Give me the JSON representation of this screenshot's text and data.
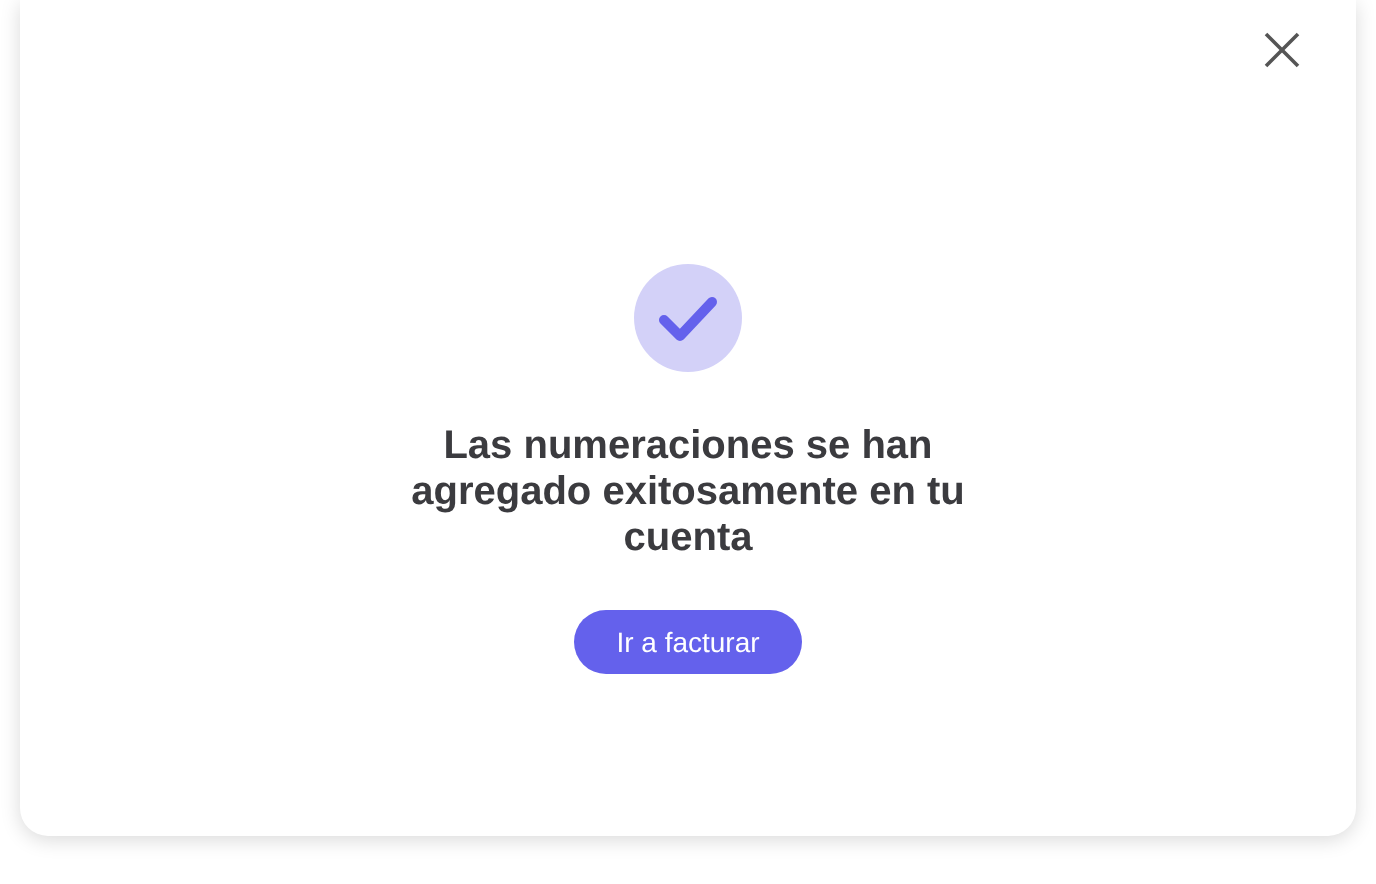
{
  "dialog": {
    "message": "Las numeraciones se han agregado exitosamente en tu cuenta",
    "button": "Ir a facturar"
  }
}
